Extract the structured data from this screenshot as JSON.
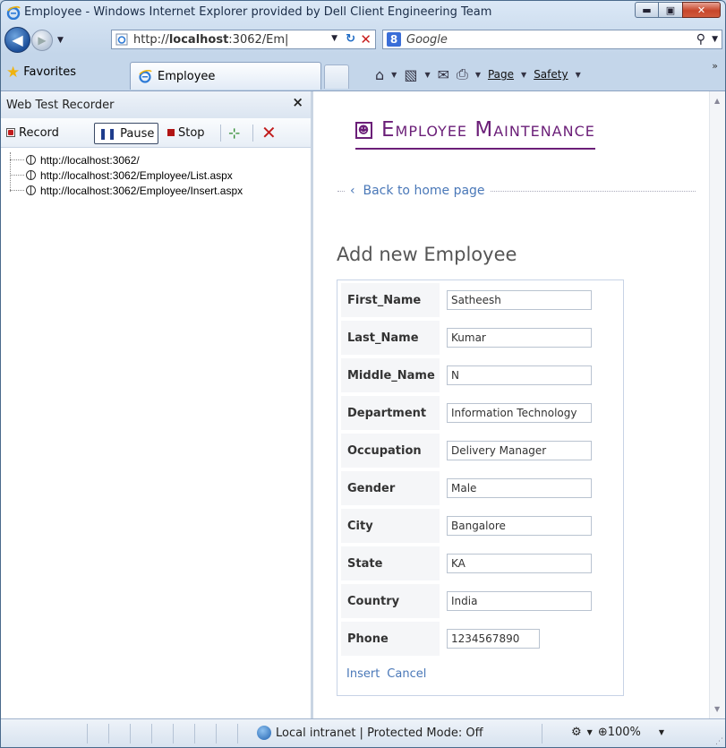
{
  "window": {
    "title": "Employee - Windows Internet Explorer provided by Dell Client Engineering Team",
    "min_symbol": "▬",
    "max_symbol": "▣",
    "close_symbol": "✕"
  },
  "address_bar": {
    "url_prefix": "http://",
    "url_host": "localhost",
    "url_rest": ":3062/Em|"
  },
  "search": {
    "engine_letter": "8",
    "placeholder": "Google"
  },
  "tabs": {
    "favorites_label": "Favorites",
    "active_tab_label": "Employee"
  },
  "command_bar": {
    "page_label": "Page",
    "safety_label": "Safety"
  },
  "recorder": {
    "title": "Web Test Recorder",
    "record_label": "Record",
    "pause_label": "Pause",
    "stop_label": "Stop",
    "items": [
      "http://localhost:3062/",
      "http://localhost:3062/Employee/List.aspx",
      "http://localhost:3062/Employee/Insert.aspx"
    ]
  },
  "page": {
    "heading": "Employee Maintenance",
    "back_link": "Back to home page",
    "section_title": "Add new Employee",
    "fields": [
      {
        "label": "First_Name",
        "value": "Satheesh"
      },
      {
        "label": "Last_Name",
        "value": "Kumar"
      },
      {
        "label": "Middle_Name",
        "value": "N"
      },
      {
        "label": "Department",
        "value": "Information Technology"
      },
      {
        "label": "Occupation",
        "value": "Delivery Manager"
      },
      {
        "label": "Gender",
        "value": "Male"
      },
      {
        "label": "City",
        "value": "Bangalore"
      },
      {
        "label": "State",
        "value": "KA"
      },
      {
        "label": "Country",
        "value": "India"
      },
      {
        "label": "Phone",
        "value": "1234567890"
      }
    ],
    "insert_label": "Insert",
    "cancel_label": "Cancel"
  },
  "status_bar": {
    "zone_text": "Local intranet | Protected Mode: Off",
    "zoom": "100%"
  }
}
